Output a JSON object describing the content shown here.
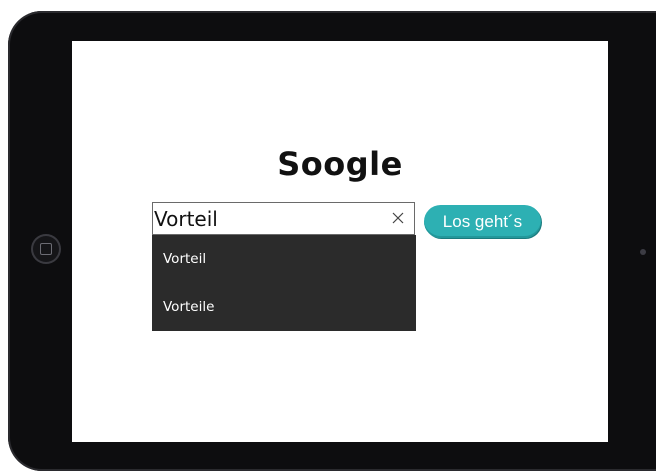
{
  "app": {
    "title": "Soogle"
  },
  "search": {
    "value": "Vorteil",
    "clear_icon": "close-icon",
    "button_label": "Los geht´s",
    "suggestions": [
      {
        "label": "Vorteil"
      },
      {
        "label": "Vorteile"
      }
    ]
  },
  "device": {
    "home_button_icon": "home-button-icon",
    "camera": "front-camera"
  },
  "colors": {
    "button": "#2db0b3",
    "dropdown_bg": "#2b2b2b",
    "bezel": "#0d0d0f"
  }
}
